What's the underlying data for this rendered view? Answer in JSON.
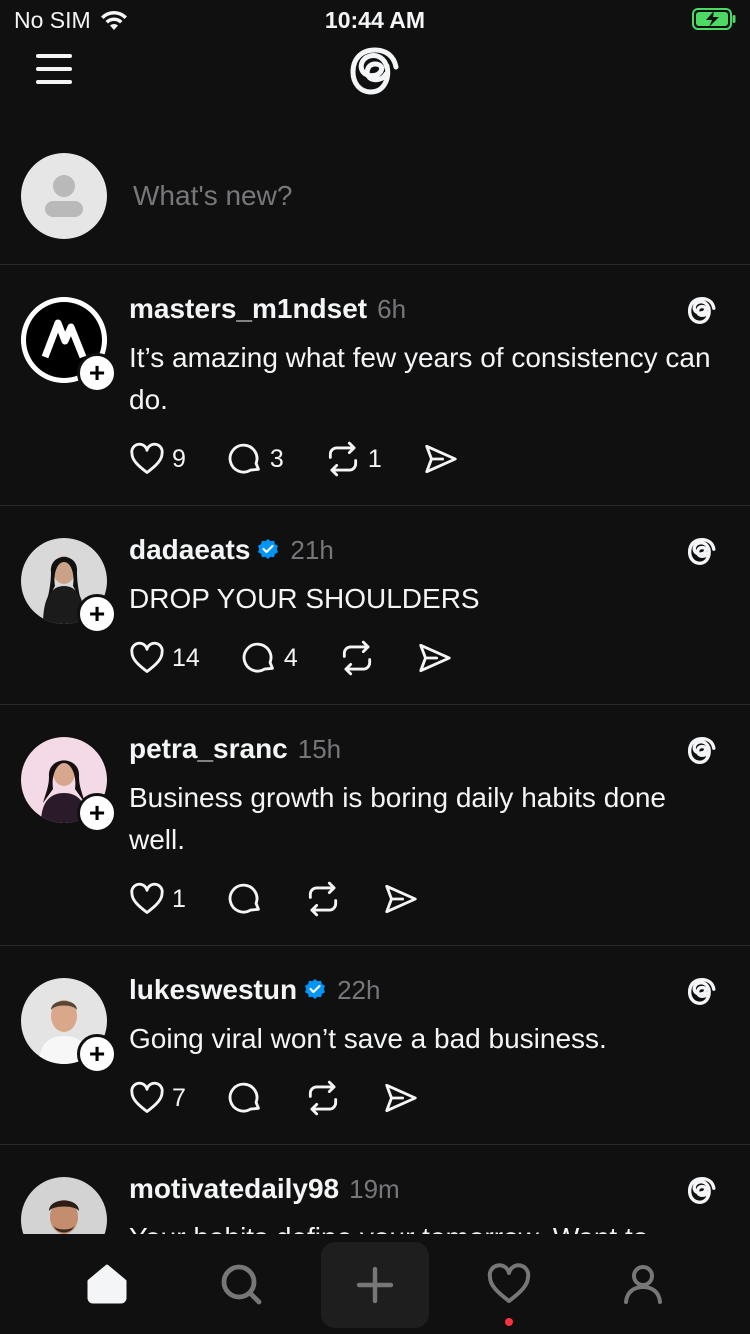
{
  "status": {
    "carrier": "No SIM",
    "time": "10:44 AM"
  },
  "composer": {
    "placeholder": "What's new?"
  },
  "posts": [
    {
      "username": "masters_m1ndset",
      "verified": false,
      "time": "6h",
      "text": "It’s amazing what few years of consistency can do.",
      "likes": "9",
      "replies": "3",
      "reposts": "1"
    },
    {
      "username": "dadaeats",
      "verified": true,
      "time": "21h",
      "text": "DROP YOUR SHOULDERS",
      "likes": "14",
      "replies": "4",
      "reposts": ""
    },
    {
      "username": "petra_sranc",
      "verified": false,
      "time": "15h",
      "text": "Business growth is boring daily habits done well.",
      "likes": "1",
      "replies": "",
      "reposts": ""
    },
    {
      "username": "lukeswestun",
      "verified": true,
      "time": "22h",
      "text": "Going viral won’t save a bad business.",
      "likes": "7",
      "replies": "",
      "reposts": ""
    },
    {
      "username": "motivatedaily98",
      "verified": false,
      "time": "19m",
      "text": "Your habits define your tomorrow. Want to",
      "likes": "",
      "replies": "",
      "reposts": ""
    }
  ],
  "colors": {
    "background": "#101010",
    "text": "#f3f5f7",
    "muted": "#77777b",
    "verified": "#0095f6",
    "notification_dot": "#ff3040",
    "battery": "#4cd964"
  },
  "icons": [
    "menu-icon",
    "threads-logo-icon",
    "heart-icon",
    "comment-icon",
    "repost-icon",
    "share-icon",
    "verified-icon",
    "home-icon",
    "search-icon",
    "plus-icon",
    "profile-icon"
  ]
}
